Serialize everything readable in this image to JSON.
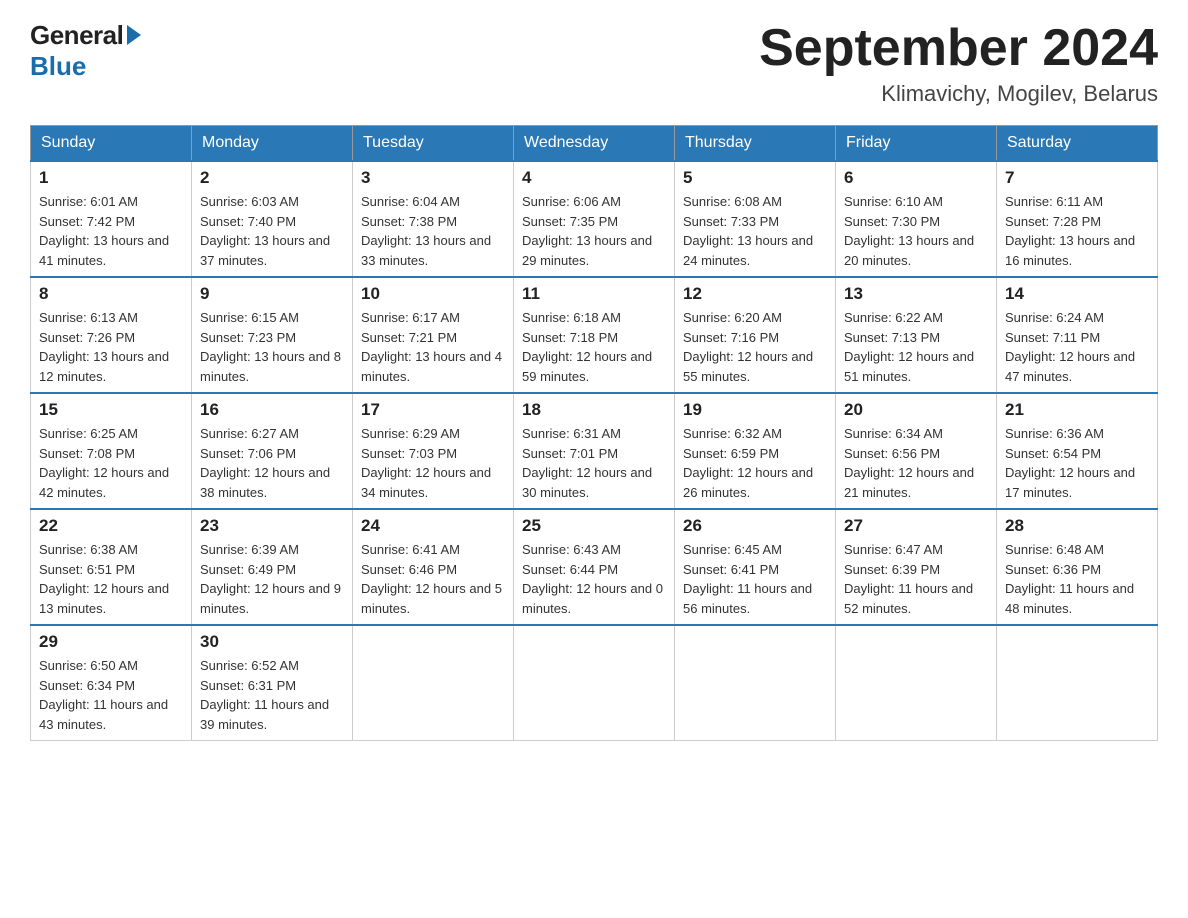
{
  "header": {
    "logo_text": "General",
    "logo_blue": "Blue",
    "month_title": "September 2024",
    "location": "Klimavichy, Mogilev, Belarus"
  },
  "days_of_week": [
    "Sunday",
    "Monday",
    "Tuesday",
    "Wednesday",
    "Thursday",
    "Friday",
    "Saturday"
  ],
  "weeks": [
    [
      {
        "day": "1",
        "sunrise": "6:01 AM",
        "sunset": "7:42 PM",
        "daylight": "13 hours and 41 minutes."
      },
      {
        "day": "2",
        "sunrise": "6:03 AM",
        "sunset": "7:40 PM",
        "daylight": "13 hours and 37 minutes."
      },
      {
        "day": "3",
        "sunrise": "6:04 AM",
        "sunset": "7:38 PM",
        "daylight": "13 hours and 33 minutes."
      },
      {
        "day": "4",
        "sunrise": "6:06 AM",
        "sunset": "7:35 PM",
        "daylight": "13 hours and 29 minutes."
      },
      {
        "day": "5",
        "sunrise": "6:08 AM",
        "sunset": "7:33 PM",
        "daylight": "13 hours and 24 minutes."
      },
      {
        "day": "6",
        "sunrise": "6:10 AM",
        "sunset": "7:30 PM",
        "daylight": "13 hours and 20 minutes."
      },
      {
        "day": "7",
        "sunrise": "6:11 AM",
        "sunset": "7:28 PM",
        "daylight": "13 hours and 16 minutes."
      }
    ],
    [
      {
        "day": "8",
        "sunrise": "6:13 AM",
        "sunset": "7:26 PM",
        "daylight": "13 hours and 12 minutes."
      },
      {
        "day": "9",
        "sunrise": "6:15 AM",
        "sunset": "7:23 PM",
        "daylight": "13 hours and 8 minutes."
      },
      {
        "day": "10",
        "sunrise": "6:17 AM",
        "sunset": "7:21 PM",
        "daylight": "13 hours and 4 minutes."
      },
      {
        "day": "11",
        "sunrise": "6:18 AM",
        "sunset": "7:18 PM",
        "daylight": "12 hours and 59 minutes."
      },
      {
        "day": "12",
        "sunrise": "6:20 AM",
        "sunset": "7:16 PM",
        "daylight": "12 hours and 55 minutes."
      },
      {
        "day": "13",
        "sunrise": "6:22 AM",
        "sunset": "7:13 PM",
        "daylight": "12 hours and 51 minutes."
      },
      {
        "day": "14",
        "sunrise": "6:24 AM",
        "sunset": "7:11 PM",
        "daylight": "12 hours and 47 minutes."
      }
    ],
    [
      {
        "day": "15",
        "sunrise": "6:25 AM",
        "sunset": "7:08 PM",
        "daylight": "12 hours and 42 minutes."
      },
      {
        "day": "16",
        "sunrise": "6:27 AM",
        "sunset": "7:06 PM",
        "daylight": "12 hours and 38 minutes."
      },
      {
        "day": "17",
        "sunrise": "6:29 AM",
        "sunset": "7:03 PM",
        "daylight": "12 hours and 34 minutes."
      },
      {
        "day": "18",
        "sunrise": "6:31 AM",
        "sunset": "7:01 PM",
        "daylight": "12 hours and 30 minutes."
      },
      {
        "day": "19",
        "sunrise": "6:32 AM",
        "sunset": "6:59 PM",
        "daylight": "12 hours and 26 minutes."
      },
      {
        "day": "20",
        "sunrise": "6:34 AM",
        "sunset": "6:56 PM",
        "daylight": "12 hours and 21 minutes."
      },
      {
        "day": "21",
        "sunrise": "6:36 AM",
        "sunset": "6:54 PM",
        "daylight": "12 hours and 17 minutes."
      }
    ],
    [
      {
        "day": "22",
        "sunrise": "6:38 AM",
        "sunset": "6:51 PM",
        "daylight": "12 hours and 13 minutes."
      },
      {
        "day": "23",
        "sunrise": "6:39 AM",
        "sunset": "6:49 PM",
        "daylight": "12 hours and 9 minutes."
      },
      {
        "day": "24",
        "sunrise": "6:41 AM",
        "sunset": "6:46 PM",
        "daylight": "12 hours and 5 minutes."
      },
      {
        "day": "25",
        "sunrise": "6:43 AM",
        "sunset": "6:44 PM",
        "daylight": "12 hours and 0 minutes."
      },
      {
        "day": "26",
        "sunrise": "6:45 AM",
        "sunset": "6:41 PM",
        "daylight": "11 hours and 56 minutes."
      },
      {
        "day": "27",
        "sunrise": "6:47 AM",
        "sunset": "6:39 PM",
        "daylight": "11 hours and 52 minutes."
      },
      {
        "day": "28",
        "sunrise": "6:48 AM",
        "sunset": "6:36 PM",
        "daylight": "11 hours and 48 minutes."
      }
    ],
    [
      {
        "day": "29",
        "sunrise": "6:50 AM",
        "sunset": "6:34 PM",
        "daylight": "11 hours and 43 minutes."
      },
      {
        "day": "30",
        "sunrise": "6:52 AM",
        "sunset": "6:31 PM",
        "daylight": "11 hours and 39 minutes."
      },
      null,
      null,
      null,
      null,
      null
    ]
  ],
  "labels": {
    "sunrise_label": "Sunrise:",
    "sunset_label": "Sunset:",
    "daylight_label": "Daylight:"
  }
}
